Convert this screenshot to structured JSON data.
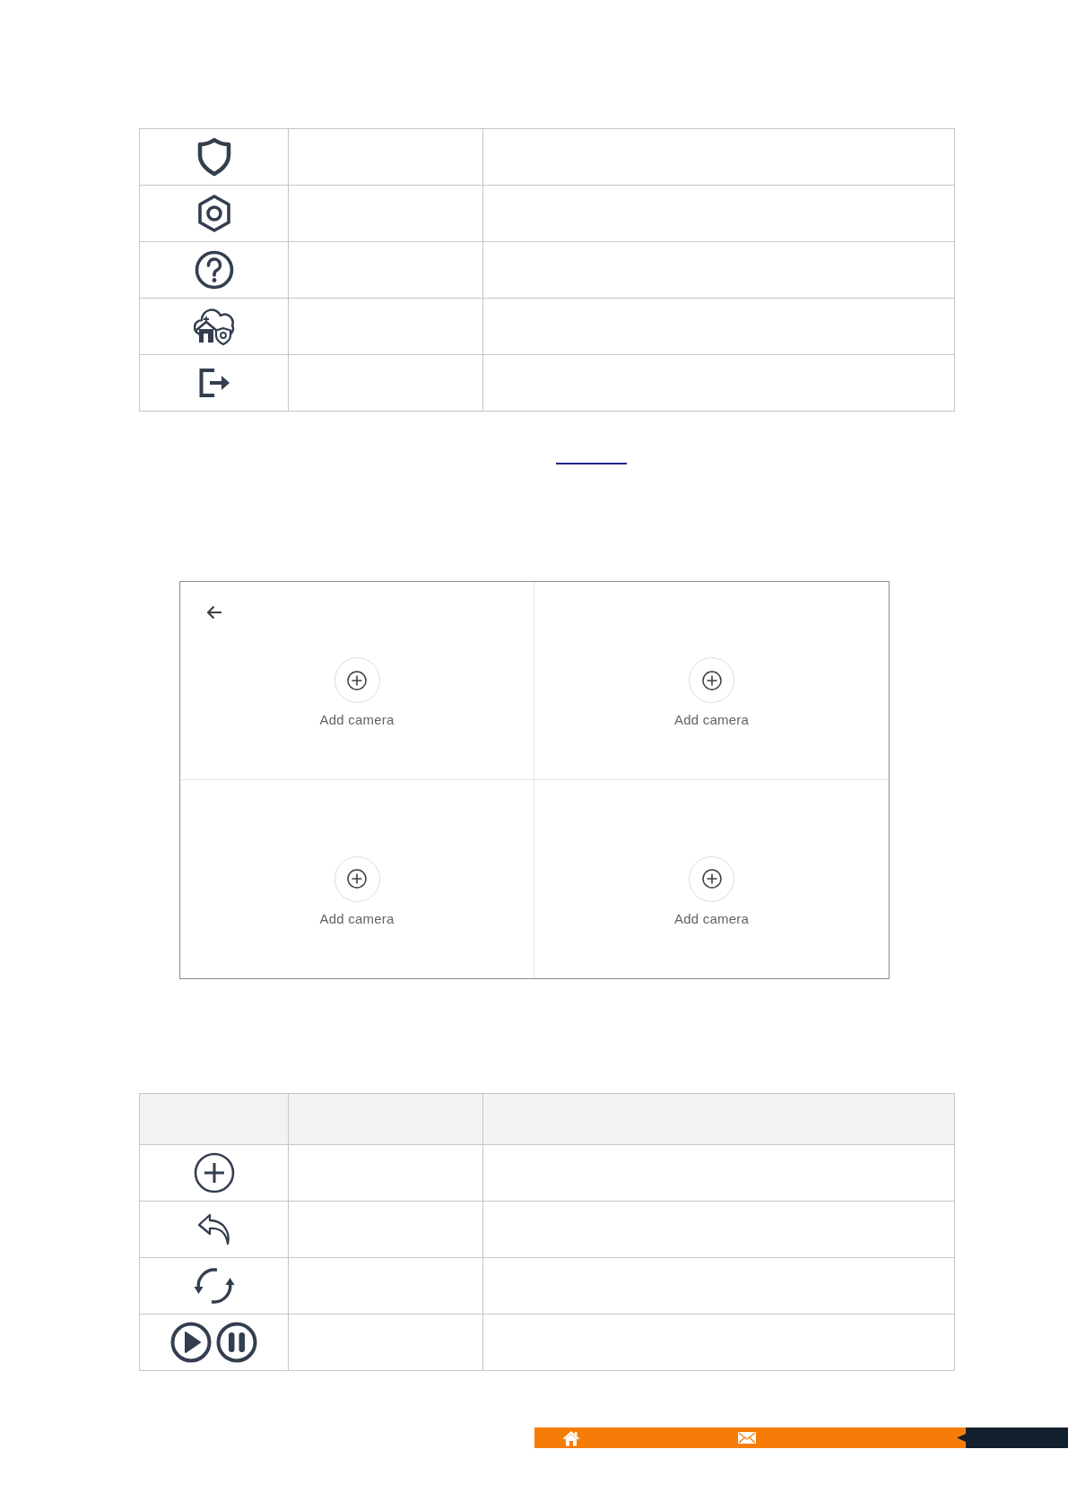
{
  "table_1": {
    "header_row": false,
    "rows": [
      {
        "kind": "shield"
      },
      {
        "kind": "nut"
      },
      {
        "kind": "question"
      },
      {
        "kind": "cloud-home"
      },
      {
        "kind": "exit"
      }
    ]
  },
  "camera_grid": {
    "back_arrow": true,
    "slots": [
      {
        "label": "Add camera"
      },
      {
        "label": "Add camera"
      },
      {
        "label": "Add camera"
      },
      {
        "label": "Add camera"
      }
    ]
  },
  "table_2": {
    "header_row": true,
    "rows": [
      {
        "kind": "plus"
      },
      {
        "kind": "reply"
      },
      {
        "kind": "refresh"
      },
      {
        "kind": "play-pause"
      }
    ]
  }
}
